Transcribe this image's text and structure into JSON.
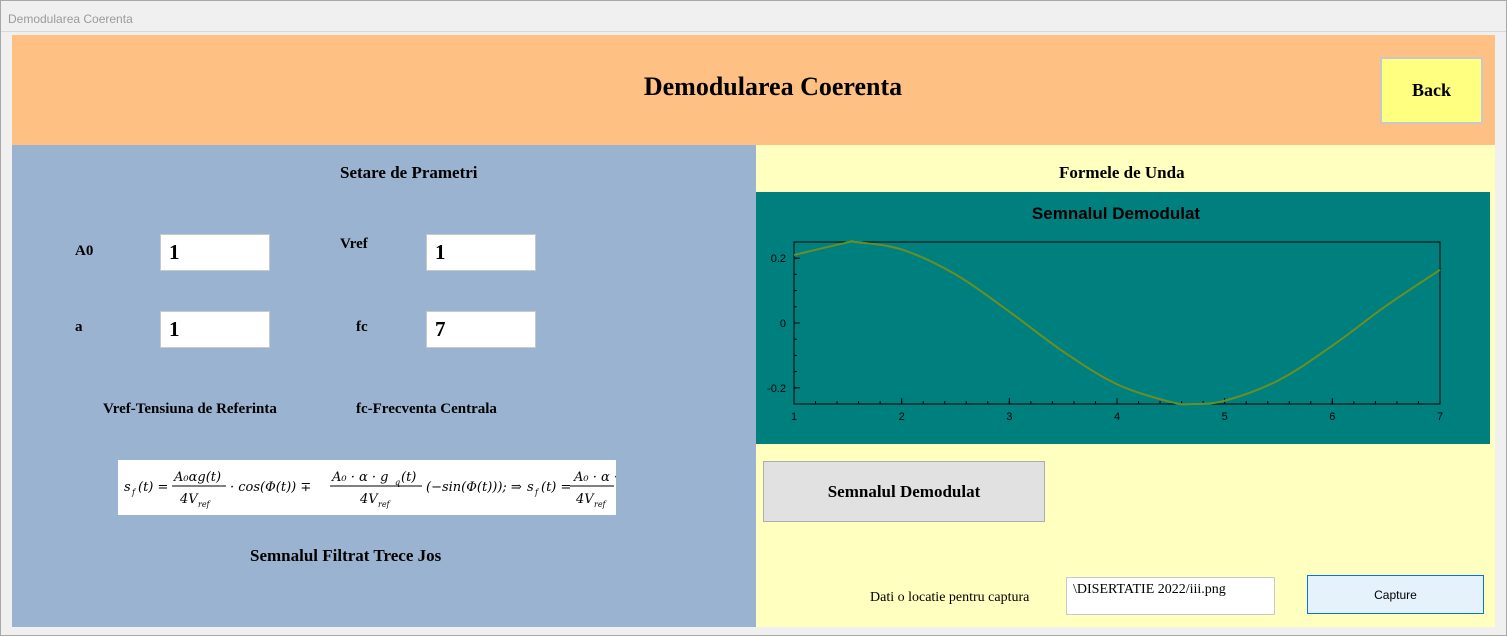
{
  "window": {
    "title": "Demodularea Coerenta"
  },
  "header": {
    "title": "Demodularea Coerenta",
    "back_label": "Back"
  },
  "params": {
    "section_title": "Setare de Prametri",
    "a0_label": "A0",
    "a0_value": "1",
    "vref_label": "Vref",
    "vref_value": "1",
    "a_label": "a",
    "a_value": "1",
    "fc_label": "fc",
    "fc_value": "7",
    "vref_note": "Vref-Tensiuna de Referinta",
    "fc_note": "fc-Frecventa Centrala",
    "filter_title": "Semnalul Filtrat Trece Jos"
  },
  "waves": {
    "section_title": "Formele de Unda",
    "chart_title": "Semnalul Demodulat",
    "demod_button": "Semnalul Demodulat",
    "location_label": "Dati o locatie pentru captura",
    "path_value": "\\DISERTATIE 2022/iii.png",
    "capture_label": "Capture"
  },
  "colors": {
    "header_bg": "#ffc083",
    "left_bg": "#9ab3d1",
    "right_bg": "#ffffc0",
    "chart_bg": "#007f7f",
    "line": "#6b8e23",
    "back_bg": "#ffff80"
  },
  "chart_data": {
    "type": "line",
    "title": "Semnalul Demodulat",
    "xlabel": "",
    "ylabel": "",
    "xlim": [
      1,
      7
    ],
    "ylim": [
      -0.25,
      0.25
    ],
    "xticks": [
      1,
      2,
      3,
      4,
      5,
      6,
      7
    ],
    "yticks": [
      -0.2,
      0,
      0.2
    ],
    "grid": false,
    "series": [
      {
        "x": [
          1,
          1.5,
          1.57,
          2,
          2.5,
          3,
          3.5,
          4,
          4.5,
          4.71,
          5,
          5.5,
          6,
          6.5,
          7
        ],
        "values": [
          0.21,
          0.249,
          0.25,
          0.227,
          0.15,
          0.035,
          -0.088,
          -0.189,
          -0.244,
          -0.25,
          -0.24,
          -0.177,
          -0.07,
          0.053,
          0.164
        ]
      }
    ]
  }
}
